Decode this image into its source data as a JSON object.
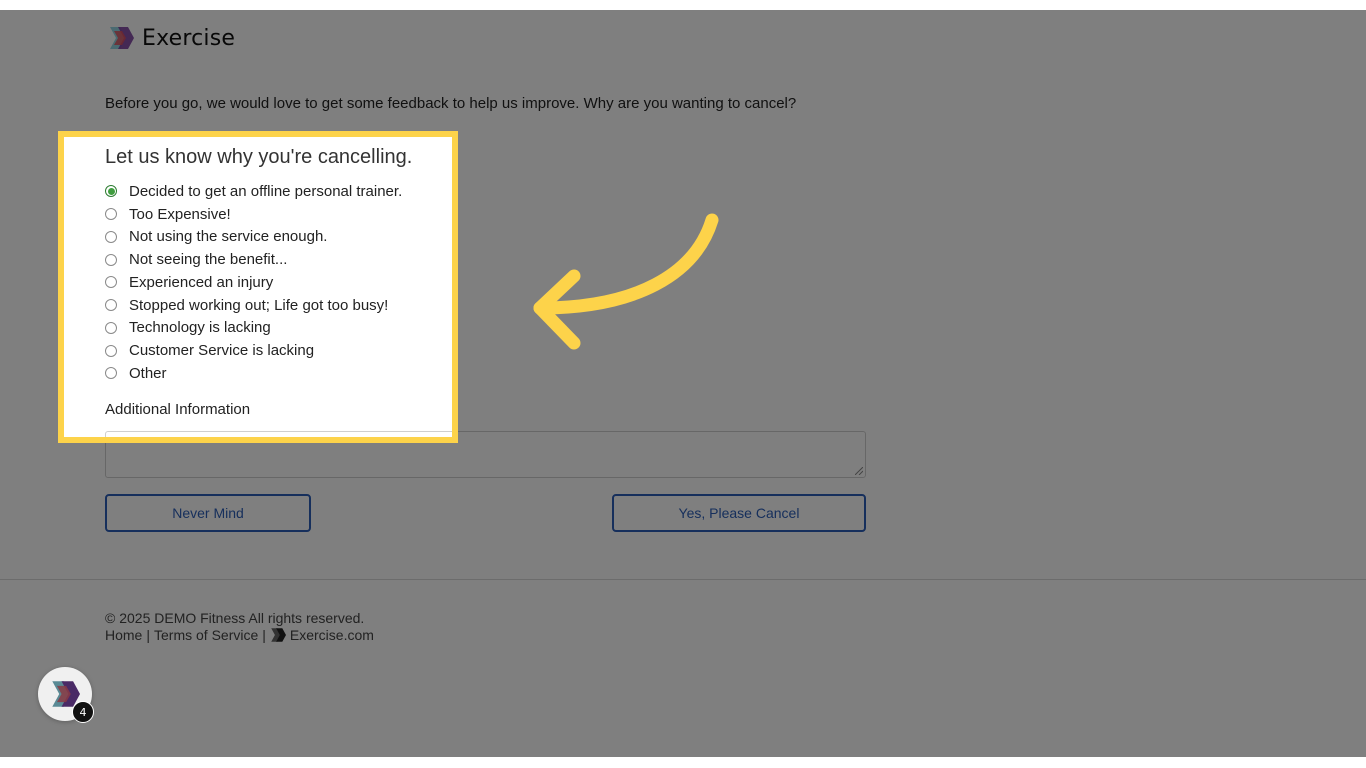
{
  "brand": {
    "name": "Exercise"
  },
  "page": {
    "intro": "Before you go, we would love to get some feedback to help us improve. Why are you wanting to cancel?",
    "form_title": "Let us know why you're cancelling.",
    "reasons": [
      {
        "label": "Decided to get an offline personal trainer.",
        "selected": true
      },
      {
        "label": "Too Expensive!",
        "selected": false
      },
      {
        "label": "Not using the service enough.",
        "selected": false
      },
      {
        "label": "Not seeing the benefit...",
        "selected": false
      },
      {
        "label": "Experienced an injury",
        "selected": false
      },
      {
        "label": "Stopped working out; Life got too busy!",
        "selected": false
      },
      {
        "label": "Technology is lacking",
        "selected": false
      },
      {
        "label": "Customer Service is lacking",
        "selected": false
      },
      {
        "label": "Other",
        "selected": false
      }
    ],
    "additional_label": "Additional Information",
    "additional_value": "",
    "never_mind_label": "Never Mind",
    "confirm_cancel_label": "Yes, Please Cancel"
  },
  "footer": {
    "copyright": "© 2025 DEMO Fitness All rights reserved.",
    "home_link": "Home",
    "separator": "|",
    "terms_link": "Terms of Service",
    "site_link": "Exercise.com"
  },
  "launcher": {
    "badge_count": "4",
    "icon": "exercise-logo-icon"
  },
  "colors": {
    "highlight": "#fdd34a",
    "button_accent": "#2d5fb8",
    "radio_selected": "#3f9d3f"
  }
}
